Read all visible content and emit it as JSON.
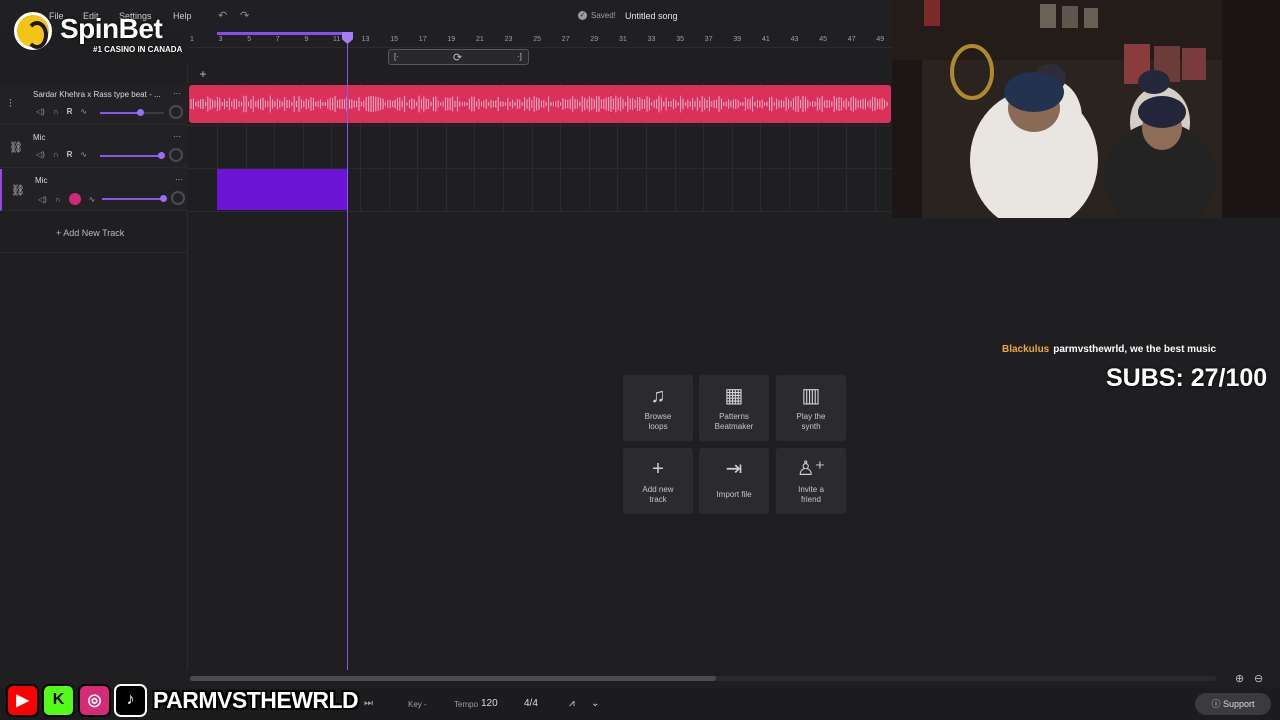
{
  "app": {
    "menu": [
      "File",
      "Edit",
      "Settings",
      "Help"
    ],
    "undo_icon": "undo-icon",
    "redo_icon": "redo-icon",
    "save_status": "Saved!",
    "song_title": "Untitled song"
  },
  "brand": {
    "name": "SpinBet",
    "tagline": "#1 CASINO IN CANADA"
  },
  "ruler": {
    "ticks": [
      "1",
      "3",
      "5",
      "7",
      "9",
      "11",
      "13",
      "15",
      "17",
      "19",
      "21",
      "23",
      "25",
      "27",
      "29",
      "31",
      "33",
      "35",
      "37",
      "39",
      "41",
      "43",
      "45",
      "47",
      "49"
    ]
  },
  "tracks": [
    {
      "name": "Sardar Khehra x Rass type beat - ...",
      "icon": "waveform-icon",
      "volume": 0.62,
      "type": "audio"
    },
    {
      "name": "Mic",
      "icon": "link-icon",
      "volume": 0.95,
      "type": "mic"
    },
    {
      "name": "Mic",
      "icon": "link-icon",
      "volume": 0.95,
      "type": "mic",
      "armed": true
    }
  ],
  "track_controls": {
    "mute_icon": "speaker-icon",
    "headphones_icon": "headphones-icon",
    "record_label": "R",
    "fx_icon": "fx-icon",
    "menu_icon": "more-icon"
  },
  "add_track_label": "Add New Track",
  "quick_actions": [
    {
      "label_1": "Browse",
      "label_2": "loops",
      "icon": "music-note-icon"
    },
    {
      "label_1": "Patterns",
      "label_2": "Beatmaker",
      "icon": "grid-icon"
    },
    {
      "label_1": "Play the",
      "label_2": "synth",
      "icon": "piano-icon"
    },
    {
      "label_1": "Add new",
      "label_2": "track",
      "icon": "plus-icon"
    },
    {
      "label_1": "Import file",
      "label_2": "",
      "icon": "import-icon"
    },
    {
      "label_1": "Invite a",
      "label_2": "friend",
      "icon": "add-person-icon"
    }
  ],
  "chat": {
    "user": "Blackulus",
    "message": "parmvsthewrld, we the best music"
  },
  "subs": "SUBS: 27/100",
  "bottom": {
    "key_label": "Key",
    "key_value": "-",
    "tempo_label": "Tempo",
    "tempo_value": "120",
    "time_signature": "4/4",
    "support_label": "Support"
  },
  "social": {
    "handle": "PARMVSTHEWRLD",
    "icons": [
      "youtube-icon",
      "kick-icon",
      "instagram-icon",
      "tiktok-icon"
    ]
  },
  "colors": {
    "accent": "#8a56f0",
    "clip_audio": "#d9305c",
    "clip_mic": "#6b14d6",
    "chat_user": "#f0a637"
  }
}
